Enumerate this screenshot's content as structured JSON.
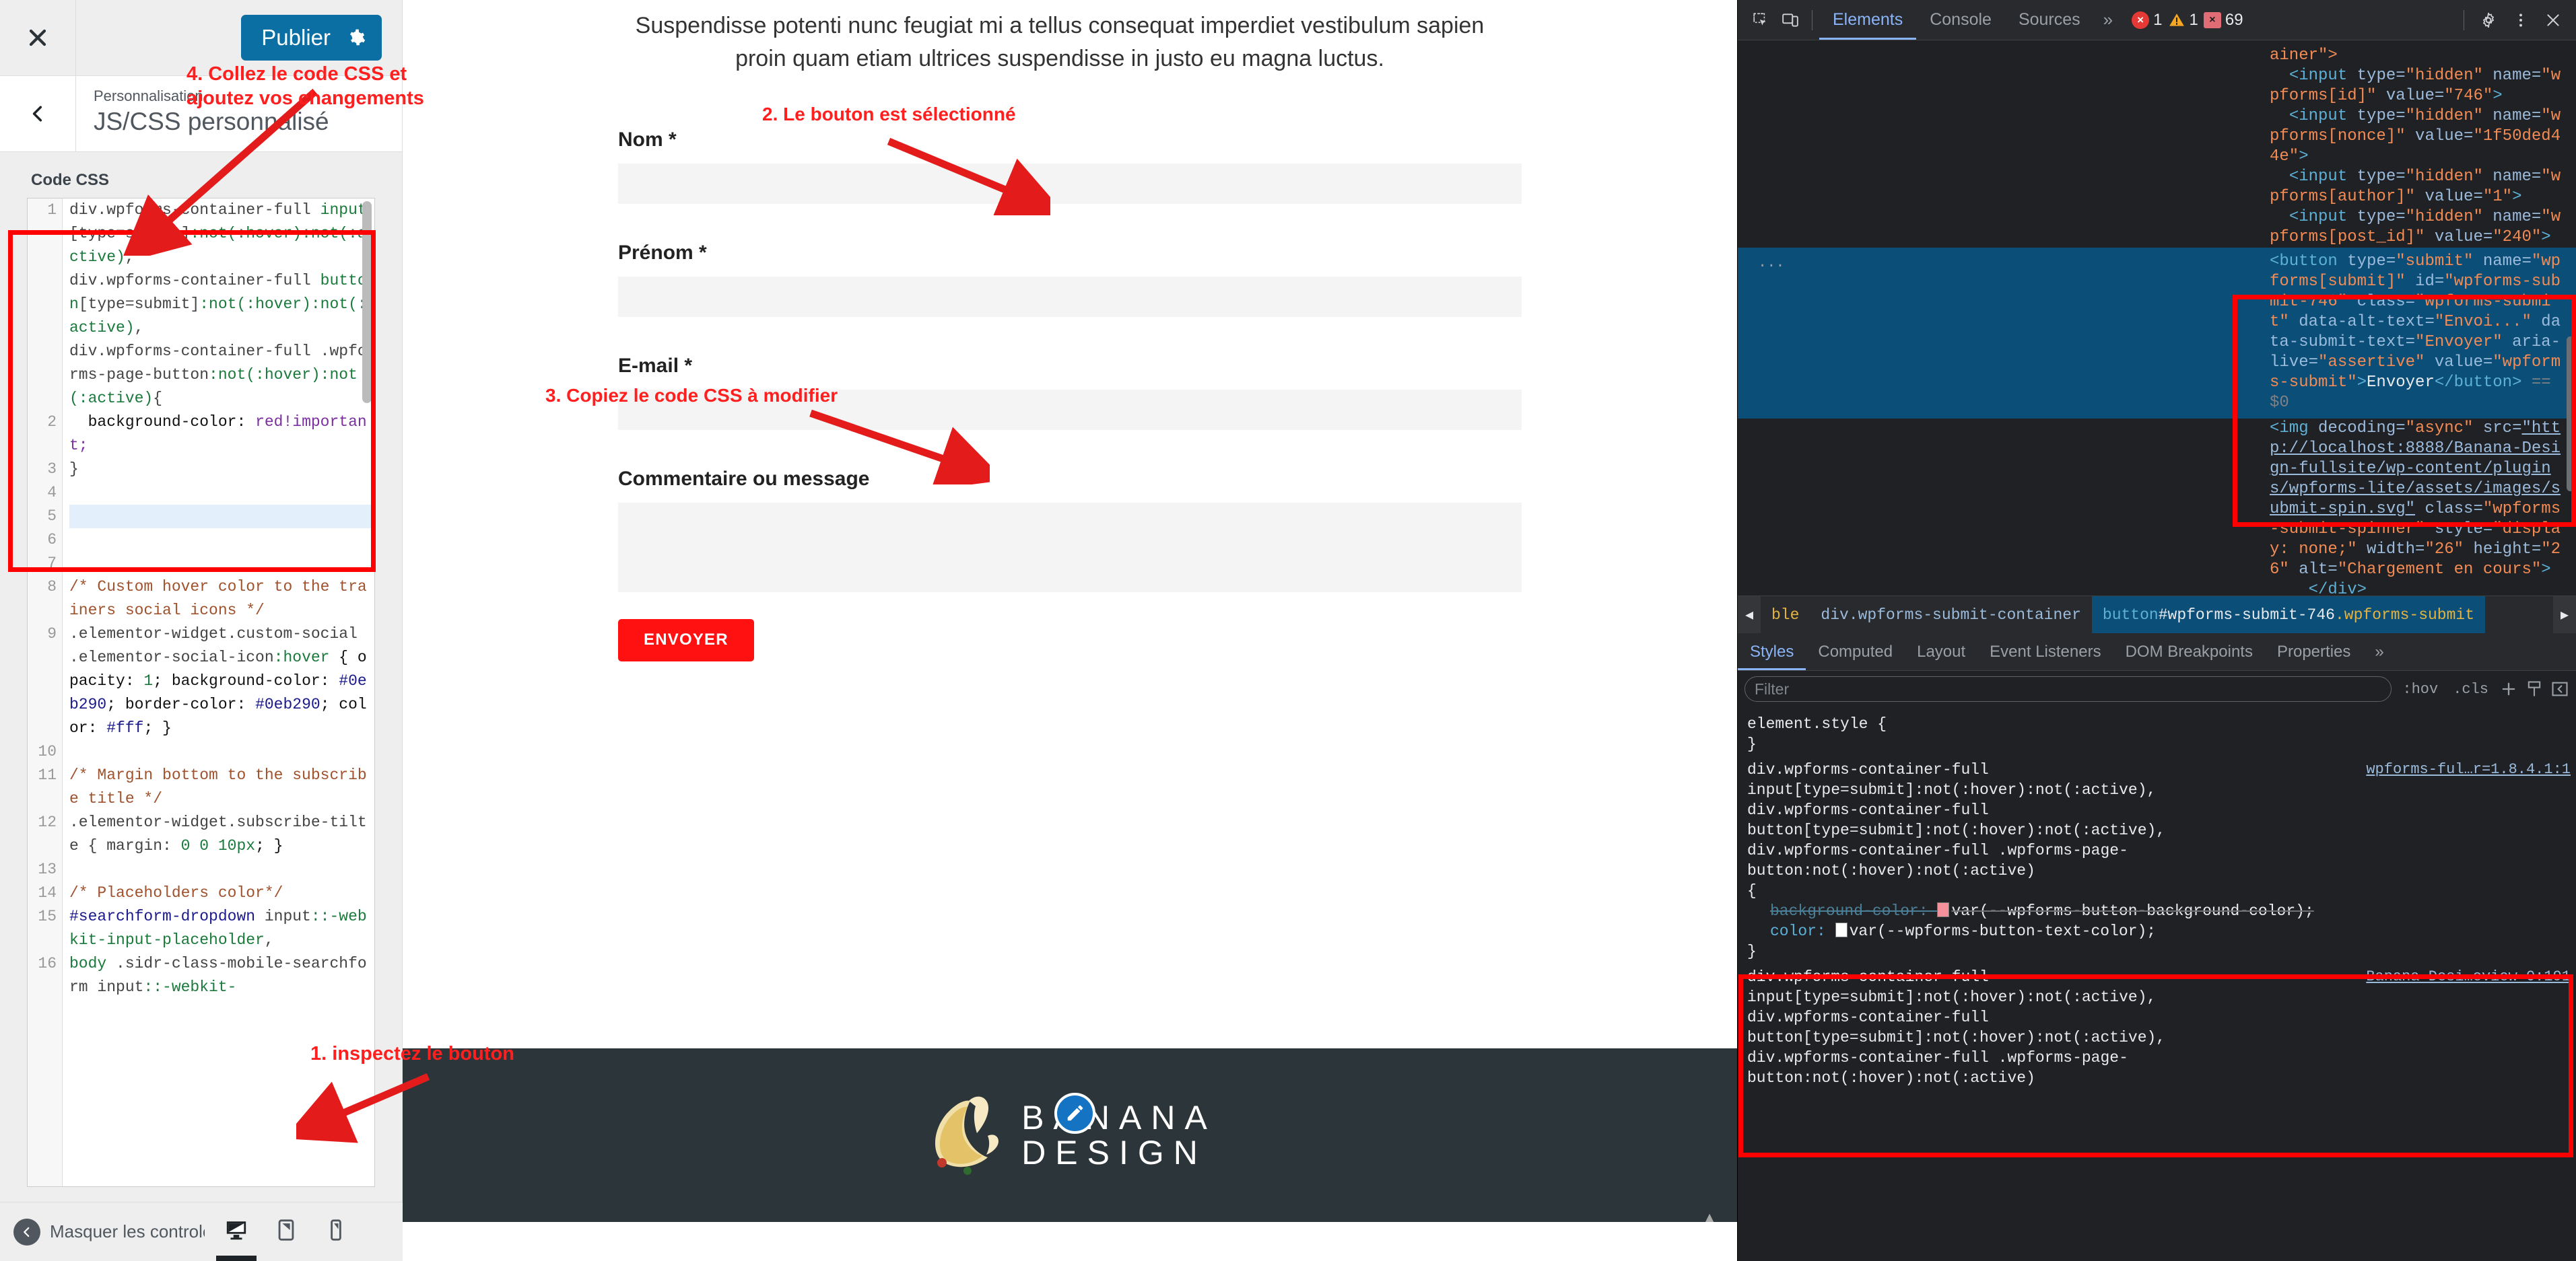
{
  "customizer": {
    "close_label": "×",
    "publish_label": "Publier",
    "eyebrow": "Personnalisation",
    "title": "JS/CSS personnalisé",
    "section_label": "Code CSS",
    "hide_controls_label": "Masquer les controles",
    "code_lines": [
      {
        "n": "1",
        "segments": [
          {
            "t": "div.wpforms-container-full ",
            "c": "tok-tag"
          },
          {
            "t": "input",
            "c": "tok-sel"
          },
          {
            "t": "[type=submit]",
            "c": "tok-tag"
          },
          {
            "t": ":not(:hover):not(:active)",
            "c": "tok-sel"
          },
          {
            "t": ",",
            "c": "tok-tag"
          },
          {
            "t": "\ndiv.wpforms-container-full ",
            "c": "tok-tag"
          },
          {
            "t": "button",
            "c": "tok-sel"
          },
          {
            "t": "[type=submit]",
            "c": "tok-tag"
          },
          {
            "t": ":not(:hover):not(:active)",
            "c": "tok-sel"
          },
          {
            "t": ",",
            "c": "tok-tag"
          },
          {
            "t": "\ndiv.wpforms-container-full .wpforms-page-button",
            "c": "tok-tag"
          },
          {
            "t": ":not(:hover):not(:active)",
            "c": "tok-sel"
          },
          {
            "t": "{",
            "c": "tok-tag"
          }
        ]
      },
      {
        "n": "2",
        "segments": [
          {
            "t": "  background-color: ",
            "c": "tok-prop"
          },
          {
            "t": "red!important;",
            "c": "tok-val"
          }
        ]
      },
      {
        "n": "3",
        "segments": [
          {
            "t": "}",
            "c": "tok-tag"
          }
        ]
      },
      {
        "n": "4",
        "segments": [
          {
            "t": "",
            "c": "tok-tag"
          }
        ]
      },
      {
        "n": "5",
        "segments": [
          {
            "t": "",
            "c": "tok-tag"
          }
        ],
        "highlight": true
      },
      {
        "n": "6",
        "segments": [
          {
            "t": "",
            "c": "tok-tag"
          }
        ]
      },
      {
        "n": "7",
        "segments": [
          {
            "t": "",
            "c": "tok-tag"
          }
        ]
      },
      {
        "n": "8",
        "segments": [
          {
            "t": "/* Custom hover color to the trainers social icons */",
            "c": "tok-com"
          }
        ]
      },
      {
        "n": "9",
        "segments": [
          {
            "t": ".elementor-widget.custom-social .elementor-social-icon",
            "c": "tok-tag"
          },
          {
            "t": ":hover",
            "c": "tok-pseudo"
          },
          {
            "t": " { opacity: ",
            "c": "tok-prop"
          },
          {
            "t": "1",
            "c": "tok-num"
          },
          {
            "t": "; background-color: ",
            "c": "tok-prop"
          },
          {
            "t": "#0eb290",
            "c": "tok-hex"
          },
          {
            "t": "; border-color: ",
            "c": "tok-prop"
          },
          {
            "t": "#0eb290",
            "c": "tok-hex"
          },
          {
            "t": "; color: ",
            "c": "tok-prop"
          },
          {
            "t": "#fff",
            "c": "tok-hex"
          },
          {
            "t": "; }",
            "c": "tok-prop"
          }
        ]
      },
      {
        "n": "10",
        "segments": [
          {
            "t": "",
            "c": "tok-tag"
          }
        ]
      },
      {
        "n": "11",
        "segments": [
          {
            "t": "/* Margin bottom to the subscribe title */",
            "c": "tok-com"
          }
        ]
      },
      {
        "n": "12",
        "segments": [
          {
            "t": ".elementor-widget.subscribe-tilte { margin: ",
            "c": "tok-tag"
          },
          {
            "t": "0 0 10px",
            "c": "tok-num"
          },
          {
            "t": "; }",
            "c": "tok-prop"
          }
        ]
      },
      {
        "n": "13",
        "segments": [
          {
            "t": "",
            "c": "tok-tag"
          }
        ]
      },
      {
        "n": "14",
        "segments": [
          {
            "t": "/* Placeholders color*/",
            "c": "tok-com"
          }
        ]
      },
      {
        "n": "15",
        "segments": [
          {
            "t": "#searchform-dropdown",
            "c": "tok-id"
          },
          {
            "t": " input",
            "c": "tok-tag"
          },
          {
            "t": "::-webkit-input-placeholder",
            "c": "tok-pseudo"
          },
          {
            "t": ",",
            "c": "tok-tag"
          }
        ]
      },
      {
        "n": "16",
        "segments": [
          {
            "t": "body",
            "c": "tok-pseudo"
          },
          {
            "t": " .sidr-class-mobile-searchform input",
            "c": "tok-tag"
          },
          {
            "t": "::-webkit-",
            "c": "tok-pseudo"
          }
        ]
      }
    ]
  },
  "preview": {
    "intro_line1": "Suspendisse potenti nunc feugiat mi a tellus consequat imperdiet vestibulum sapien proin",
    "intro_line2": "quam etiam ultrices suspendisse in justo eu magna luctus.",
    "fields": [
      {
        "label": "Nom *",
        "type": "input",
        "value": ""
      },
      {
        "label": "Prénom *",
        "type": "input",
        "value": ""
      },
      {
        "label": "E-mail *",
        "type": "input",
        "value": ""
      },
      {
        "label": "Commentaire ou message",
        "type": "textarea",
        "value": ""
      }
    ],
    "submit_label": "ENVOYER",
    "submit_color": "#ff1111",
    "logo_line1": "BANANA",
    "logo_line2": "DESIGN",
    "footer_bg": "#2c3539"
  },
  "devtools": {
    "tabs": [
      {
        "label": "Elements",
        "active": true
      },
      {
        "label": "Console",
        "active": false
      },
      {
        "label": "Sources",
        "active": false
      }
    ],
    "more_tabs": "»",
    "error_count": "1",
    "warning_count": "1",
    "info_count": "69",
    "dom_lines_top": [
      {
        "segs": [
          {
            "t": "ainer\">",
            "c": "dom-val"
          }
        ]
      },
      {
        "segs": [
          {
            "t": "  <input ",
            "c": "dom-tag"
          },
          {
            "t": "type=",
            "c": "dom-attr"
          },
          {
            "t": "\"hidden\"",
            "c": "dom-val"
          },
          {
            "t": " name=",
            "c": "dom-attr"
          },
          {
            "t": "\"wpforms[id]\"",
            "c": "dom-val"
          },
          {
            "t": " value=",
            "c": "dom-attr"
          },
          {
            "t": "\"746\"",
            "c": "dom-val"
          },
          {
            "t": ">",
            "c": "dom-tag"
          }
        ]
      },
      {
        "segs": [
          {
            "t": "  <input ",
            "c": "dom-tag"
          },
          {
            "t": "type=",
            "c": "dom-attr"
          },
          {
            "t": "\"hidden\"",
            "c": "dom-val"
          },
          {
            "t": " name=",
            "c": "dom-attr"
          },
          {
            "t": "\"wpforms[nonce]\"",
            "c": "dom-val"
          },
          {
            "t": " value=",
            "c": "dom-attr"
          },
          {
            "t": "\"1f50ded44e\"",
            "c": "dom-val"
          },
          {
            "t": ">",
            "c": "dom-tag"
          }
        ]
      },
      {
        "segs": [
          {
            "t": "  <input ",
            "c": "dom-tag"
          },
          {
            "t": "type=",
            "c": "dom-attr"
          },
          {
            "t": "\"hidden\"",
            "c": "dom-val"
          },
          {
            "t": " name=",
            "c": "dom-attr"
          },
          {
            "t": "\"wpforms[author]\"",
            "c": "dom-val"
          },
          {
            "t": " value=",
            "c": "dom-attr"
          },
          {
            "t": "\"1\"",
            "c": "dom-val"
          },
          {
            "t": ">",
            "c": "dom-tag"
          }
        ]
      },
      {
        "segs": [
          {
            "t": "  <input ",
            "c": "dom-tag"
          },
          {
            "t": "type=",
            "c": "dom-attr"
          },
          {
            "t": "\"hidden\"",
            "c": "dom-val"
          },
          {
            "t": " name=",
            "c": "dom-attr"
          },
          {
            "t": "\"wpforms[post_id]\"",
            "c": "dom-val"
          },
          {
            "t": " value=",
            "c": "dom-attr"
          },
          {
            "t": "\"240\"",
            "c": "dom-val"
          },
          {
            "t": ">",
            "c": "dom-tag"
          }
        ]
      }
    ],
    "dom_selected": {
      "ellipsis": "...",
      "segs": [
        {
          "t": "<button ",
          "c": "dom-tag"
        },
        {
          "t": "type=",
          "c": "dom-attr"
        },
        {
          "t": "\"submit\"",
          "c": "dom-val"
        },
        {
          "t": " name=",
          "c": "dom-attr"
        },
        {
          "t": "\"wpforms[submit]\"",
          "c": "dom-val"
        },
        {
          "t": " id=",
          "c": "dom-attr"
        },
        {
          "t": "\"wpforms-submit-746\"",
          "c": "dom-val"
        },
        {
          "t": " class=",
          "c": "dom-attr"
        },
        {
          "t": "\"wpforms-submit\"",
          "c": "dom-val"
        },
        {
          "t": " data-alt-text=",
          "c": "dom-attr"
        },
        {
          "t": "\"Envoi...\"",
          "c": "dom-val"
        },
        {
          "t": " data-submit-text=",
          "c": "dom-attr"
        },
        {
          "t": "\"Envoyer\"",
          "c": "dom-val"
        },
        {
          "t": " aria-live=",
          "c": "dom-attr"
        },
        {
          "t": "\"assertive\"",
          "c": "dom-val"
        },
        {
          "t": " value=",
          "c": "dom-attr"
        },
        {
          "t": "\"wpforms-submit\"",
          "c": "dom-val"
        },
        {
          "t": ">",
          "c": "dom-tag"
        },
        {
          "t": "Envoyer",
          "c": "dom-txt"
        },
        {
          "t": "</button>",
          "c": "dom-tag"
        },
        {
          "t": " == $0",
          "c": "dom-comment"
        }
      ]
    },
    "dom_lines_bottom": [
      {
        "segs": [
          {
            "t": "<img ",
            "c": "dom-tag"
          },
          {
            "t": "decoding=",
            "c": "dom-attr"
          },
          {
            "t": "\"async\"",
            "c": "dom-val"
          },
          {
            "t": " src=",
            "c": "dom-attr"
          },
          {
            "t": "\"http://localhost:8888/Banana-Design-fullsite/wp-content/plugins/wpforms-lite/assets/images/submit-spin.svg\"",
            "c": "dom-link"
          },
          {
            "t": " class=",
            "c": "dom-attr"
          },
          {
            "t": "\"wpforms-submit-spinner\"",
            "c": "dom-val"
          },
          {
            "t": " style=",
            "c": "dom-attr"
          },
          {
            "t": "\"display: none;\"",
            "c": "dom-val"
          },
          {
            "t": " width=",
            "c": "dom-attr"
          },
          {
            "t": "\"26\"",
            "c": "dom-val"
          },
          {
            "t": " height=",
            "c": "dom-attr"
          },
          {
            "t": "\"26\"",
            "c": "dom-val"
          },
          {
            "t": " alt=",
            "c": "dom-attr"
          },
          {
            "t": "\"Chargement en cours\"",
            "c": "dom-val"
          },
          {
            "t": ">",
            "c": "dom-tag"
          }
        ]
      },
      {
        "segs": [
          {
            "t": "    </div>",
            "c": "dom-tag"
          }
        ]
      }
    ],
    "breadcrumb": [
      {
        "label": "ble",
        "kind": "dim"
      },
      {
        "label": "div.wpforms-submit-container",
        "kind": "plain"
      },
      {
        "label": "button#wpforms-submit-746.wpforms-submit",
        "kind": "selected",
        "tag": "button",
        "id": "#wpforms-submit-746",
        "cls": ".wpforms-submit"
      }
    ],
    "styles_tabs": [
      {
        "label": "Styles",
        "active": true
      },
      {
        "label": "Computed",
        "active": false
      },
      {
        "label": "Layout",
        "active": false
      },
      {
        "label": "Event Listeners",
        "active": false
      },
      {
        "label": "DOM Breakpoints",
        "active": false
      },
      {
        "label": "Properties",
        "active": false
      }
    ],
    "styles_more": "»",
    "filter_placeholder": "Filter",
    "filter_value": "",
    "filter_buttons": [
      ":hov",
      ".cls"
    ],
    "rules": [
      {
        "selector": "element.style {",
        "close": "}",
        "source": "",
        "declarations": []
      },
      {
        "selector": "div.wpforms-container-full input[type=submit]:not(:hover):not(:active),\ndiv.wpforms-container-full button[type=submit]:not(:hover):not(:active),\ndiv.wpforms-container-full .wpforms-page-button:not(:hover):not(:active)\n{",
        "close": "}",
        "source": "wpforms-ful…r=1.8.4.1:1",
        "declarations": [
          {
            "prop": "background-color:",
            "value": "var(--wpforms-button-background-color);",
            "struck": true,
            "swatch": "pink"
          },
          {
            "prop": "color:",
            "value": "var(--wpforms-button-text-color);",
            "struck": false,
            "swatch": "white"
          }
        ]
      },
      {
        "selector": "div.wpforms-container-full input[type=submit]:not(:hover):not(:active),\ndiv.wpforms-container-full button[type=submit]:not(:hover):not(:active),\ndiv.wpforms-container-full .wpforms-page-button:not(:hover):not(:active)",
        "close": "",
        "source": "Banana-Desi…eview-0:191",
        "declarations": []
      }
    ]
  },
  "annotations": [
    {
      "id": "step4",
      "text": "4. Collez le code CSS et\najoutez vos changements"
    },
    {
      "id": "step1",
      "text": "1. inspectez le bouton"
    },
    {
      "id": "step2",
      "text": "2. Le bouton est sélectionné"
    },
    {
      "id": "step3",
      "text": "3. Copiez le code CSS à modifier"
    }
  ]
}
